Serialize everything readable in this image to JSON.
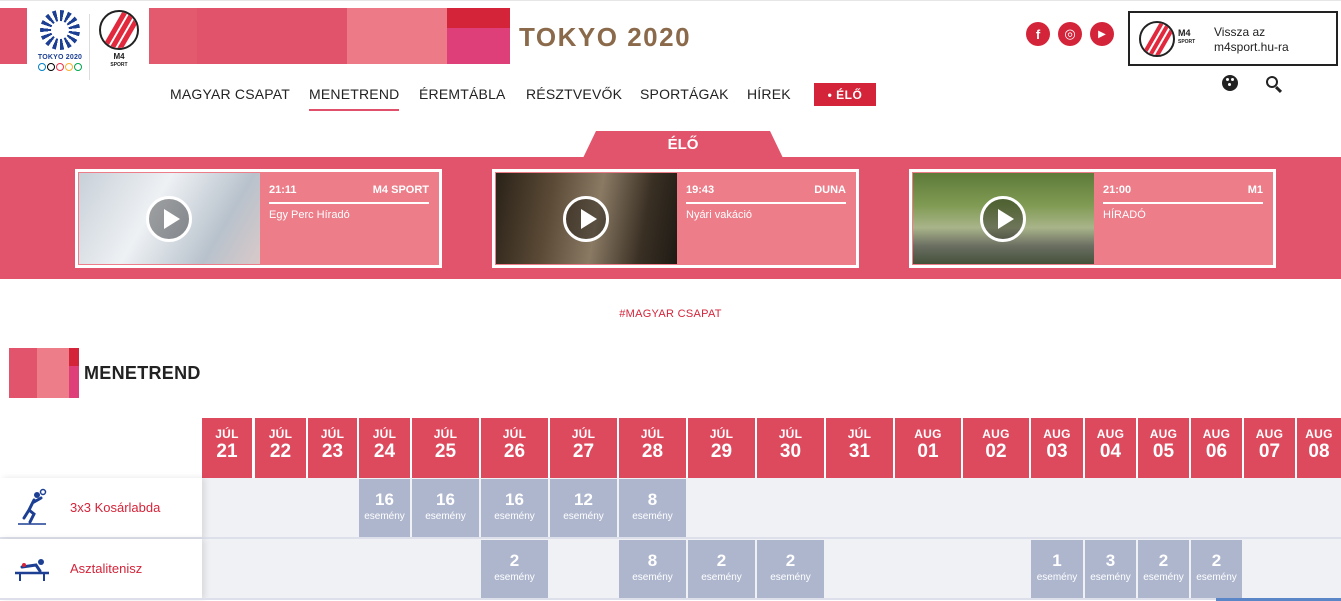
{
  "header": {
    "logo_tokyo_text": "TOKYO 2020",
    "logo_m4_text": "M4",
    "logo_m4_sub": "SPORT",
    "title": "TOKYO 2020",
    "social": [
      {
        "name": "facebook-icon",
        "glyph": "f"
      },
      {
        "name": "instagram-icon",
        "glyph": "◎"
      },
      {
        "name": "youtube-icon",
        "glyph": "▶"
      }
    ],
    "back_link": {
      "line1": "Vissza az",
      "line2": "m4sport.hu-ra",
      "logo_text": "M4",
      "logo_sub": "SPORT"
    }
  },
  "nav": {
    "items": [
      "MAGYAR CSAPAT",
      "MENETREND",
      "ÉREMTÁBLA",
      "RÉSZTVEVŐK",
      "SPORTÁGAK",
      "HÍREK"
    ],
    "active": "MENETREND",
    "live_label": "• ÉLŐ"
  },
  "live": {
    "tab_label": "ÉLŐ",
    "cards": [
      {
        "time": "21:11",
        "channel": "M4 SPORT",
        "title": "Egy Perc Híradó"
      },
      {
        "time": "19:43",
        "channel": "DUNA",
        "title": "Nyári vakáció"
      },
      {
        "time": "21:00",
        "channel": "M1",
        "title": "HÍRADÓ"
      }
    ]
  },
  "hashtag": "#MAGYAR CSAPAT",
  "schedule": {
    "title": "MENETREND",
    "dates": [
      {
        "month": "JÚL",
        "day": "21"
      },
      {
        "month": "JÚL",
        "day": "22"
      },
      {
        "month": "JÚL",
        "day": "23"
      },
      {
        "month": "JÚL",
        "day": "24"
      },
      {
        "month": "JÚL",
        "day": "25"
      },
      {
        "month": "JÚL",
        "day": "26"
      },
      {
        "month": "JÚL",
        "day": "27"
      },
      {
        "month": "JÚL",
        "day": "28"
      },
      {
        "month": "JÚL",
        "day": "29"
      },
      {
        "month": "JÚL",
        "day": "30"
      },
      {
        "month": "JÚL",
        "day": "31"
      },
      {
        "month": "AUG",
        "day": "01"
      },
      {
        "month": "AUG",
        "day": "02"
      },
      {
        "month": "AUG",
        "day": "03"
      },
      {
        "month": "AUG",
        "day": "04"
      },
      {
        "month": "AUG",
        "day": "05"
      },
      {
        "month": "AUG",
        "day": "06"
      },
      {
        "month": "AUG",
        "day": "07"
      },
      {
        "month": "AUG",
        "day": "08"
      }
    ],
    "event_label": "esemény",
    "rows": [
      {
        "sport": "3x3 Kosárlabda",
        "icon": "basketball-3x3-icon",
        "events": {
          "JÚL 24": 16,
          "JÚL 25": 16,
          "JÚL 26": 16,
          "JÚL 27": 12,
          "JÚL 28": 8
        }
      },
      {
        "sport": "Asztalitenisz",
        "icon": "table-tennis-icon",
        "events": {
          "JÚL 26": 2,
          "JÚL 28": 8,
          "JÚL 29": 2,
          "JÚL 30": 2,
          "AUG 03": 1,
          "AUG 04": 3,
          "AUG 05": 2,
          "AUG 06": 2
        }
      }
    ]
  },
  "colors": {
    "accent": "#d4243a",
    "pink": "#e2546c",
    "card_pink": "#ec7d89",
    "date_header": "#dd4a5e",
    "event_cell": "#aeb6ce",
    "row_background": "#f0f1f5",
    "title_gold": "#8a6a4a"
  }
}
